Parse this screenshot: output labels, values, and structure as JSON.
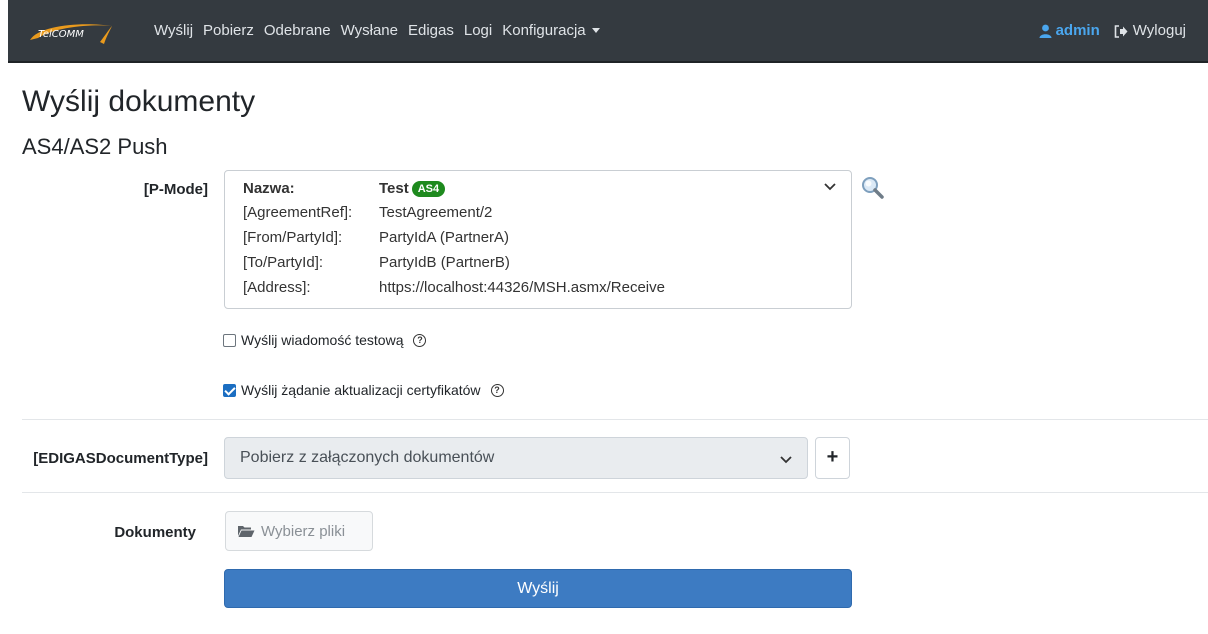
{
  "brand": {
    "logo_text": "TelCOMM"
  },
  "nav": {
    "items": [
      "Wyślij",
      "Pobierz",
      "Odebrane",
      "Wysłane",
      "Edigas",
      "Logi"
    ],
    "dropdown_label": "Konfiguracja",
    "user": "admin",
    "logout": "Wyloguj"
  },
  "page": {
    "title": "Wyślij dokumenty",
    "subtitle": "AS4/AS2 Push"
  },
  "pmode": {
    "label": "[P-Mode]",
    "name_key": "Nazwa:",
    "name_value": "Test",
    "badge": "AS4",
    "rows": [
      {
        "key": "[AgreementRef]:",
        "value": "TestAgreement/2"
      },
      {
        "key": "[From/PartyId]:",
        "value": "PartyIdA (PartnerA)"
      },
      {
        "key": "[To/PartyId]:",
        "value": "PartyIdB (PartnerB)"
      },
      {
        "key": "[Address]:",
        "value": "https://localhost:44326/MSH.asmx/Receive"
      }
    ]
  },
  "options": {
    "test_message": {
      "label": "Wyślij wiadomość testową",
      "checked": false
    },
    "cert_update": {
      "label": "Wyślij żądanie aktualizacji certyfikatów",
      "checked": true
    }
  },
  "doctype": {
    "label": "[EDIGASDocumentType]",
    "selected": "Pobierz z załączonych dokumentów",
    "add_label": "+"
  },
  "documents": {
    "label": "Dokumenty",
    "button": "Wybierz pliki"
  },
  "submit": {
    "label": "Wyślij"
  },
  "colors": {
    "navbar": "#343a40",
    "accent": "#3d7bc2",
    "badge": "#1e8a1e",
    "admin": "#4aa6ee"
  }
}
